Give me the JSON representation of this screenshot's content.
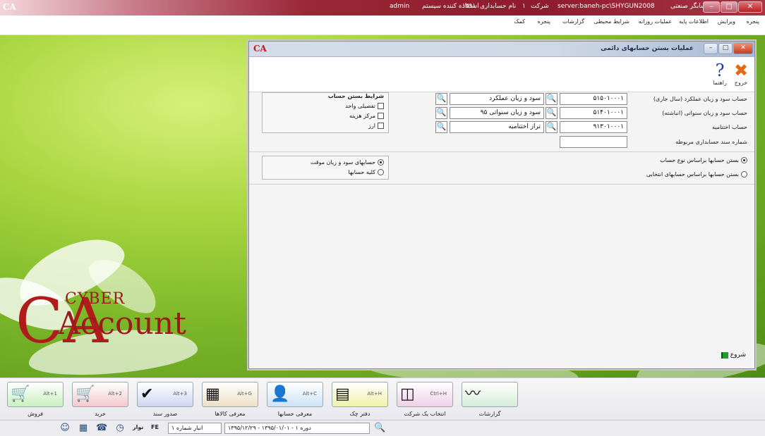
{
  "titlebar": {
    "app_logo": "CA",
    "user": "admin",
    "user_label": "استفاده کننده سیستم",
    "year": "۱۳۹۱",
    "year_label": "نام حسابداری",
    "company": "۱",
    "company_label": "شرکت",
    "server": "server:baneh-pc\\SHYGUN2008",
    "app_title": "حسابگر صنعتی",
    "min": "–",
    "max": "□",
    "close": "✕"
  },
  "menu": {
    "row1": [
      "پنجره",
      "ویرایش",
      "اطلاعات پایه",
      "عملیات روزانه",
      "شرایط محیطی",
      "گزارشات",
      "پنجره",
      "کمک"
    ],
    "row1_right": "پنجره",
    "items": [
      "ویرایش",
      "اطلاعات پایه",
      "عملیات روزانه",
      "شرایط محیطی",
      "گزارشات",
      "پنجره",
      "کمک"
    ]
  },
  "logo": {
    "ca": "CA",
    "cyber": "CYBER",
    "account": "Account"
  },
  "dialog": {
    "caption": "عملیات بستن حسابهای دائمی",
    "logo": "CA",
    "exit_label": "خروج",
    "help_label": "راهنما",
    "exit_glyph": "✖",
    "help_glyph": "?",
    "rows": [
      {
        "label": "حساب سود و زیان عملکرد (سال جاری)",
        "code": "۵۱۵۰۱۰۰۰۱",
        "name": "سود و زیان عملکرد"
      },
      {
        "label": "حساب سود و زیان سنواتی (انباشته)",
        "code": "۵۱۴۰۱۰۰۰۱",
        "name": "سود و زیان سنواتی ۹۵"
      },
      {
        "label": "حساب اختتامیه",
        "code": "۹۱۳۰۱۰۰۰۱",
        "name": "تراز اختتامیه"
      }
    ],
    "doc_label": "شماره سند حسابداری مربوطه",
    "doc_value": "",
    "conditions_title": "شرایط بستن حساب",
    "conditions": [
      "تفصیلی واحد",
      "مرکز هزینه",
      "ارز"
    ],
    "close_by_type": "بستن حسابها براساس نوع حساب",
    "close_by_selected": "بستن حسابها براساس حسابهای انتخابی",
    "temp_accounts": "حسابهای سود و زیان موقت",
    "all_accounts": "کلیه حسابها",
    "start_label": "شروع",
    "lookup_glyph": "🔍"
  },
  "shortcuts": [
    {
      "label": "فروش",
      "key": "Alt+1",
      "icon": "cart-icon",
      "glyph": "🛒",
      "color": "#c8f0c0"
    },
    {
      "label": "خرید",
      "key": "Alt+2",
      "icon": "cart-red-icon",
      "glyph": "🛒",
      "color": "#f3c9cc"
    },
    {
      "label": "صدور سند",
      "key": "Alt+3",
      "icon": "document-icon",
      "glyph": "✔",
      "color": "#cfd5f2"
    },
    {
      "label": "معرفی کالاها",
      "key": "Alt+G",
      "icon": "box-icon",
      "glyph": "▦",
      "color": "#efe0c6"
    },
    {
      "label": "معرفی حسابها",
      "key": "Alt+C",
      "icon": "person-icon",
      "glyph": "👤",
      "color": "#cde3f5"
    },
    {
      "label": "دفتر چک",
      "key": "Alt+H",
      "icon": "cheque-icon",
      "glyph": "▤",
      "color": "#eef2a9"
    },
    {
      "label": "انتخاب یک شرکت",
      "key": "Ctrl+H",
      "icon": "company-icon",
      "glyph": "◫",
      "color": "#f0cfe8"
    },
    {
      "label": "گزارشات",
      "key": "",
      "icon": "report-icon",
      "glyph": "〰",
      "color": "#d6ecd8"
    }
  ],
  "status": {
    "lookup_glyph": "🔍",
    "period": "دوره ۱ - ۱۳۹۵/۰۱/۰۱ - ۱۳۹۵/۱۲/۲۹",
    "warehouse": "انبار شماره ۱",
    "lang": "FE",
    "mode": "نوار",
    "icons": [
      "help-icon",
      "calculator-icon",
      "phone-icon",
      "clock-icon"
    ],
    "glyphs": [
      "☺",
      "▦",
      "☎",
      "◷"
    ]
  }
}
